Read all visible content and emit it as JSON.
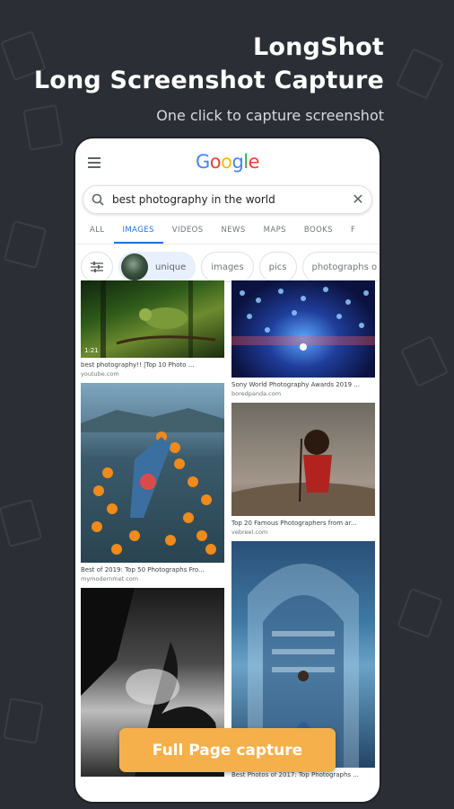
{
  "hero": {
    "line1": "LongShot",
    "line2": "Long Screenshot Capture",
    "subtitle": "One click to capture screenshot"
  },
  "google": {
    "logo_letters": [
      "G",
      "o",
      "o",
      "g",
      "l",
      "e"
    ],
    "logo_colors": [
      "#4285f4",
      "#ea4335",
      "#fbbc05",
      "#4285f4",
      "#34a853",
      "#ea4335"
    ]
  },
  "search": {
    "query": "best photography in the world"
  },
  "tabs": [
    "ALL",
    "IMAGES",
    "VIDEOS",
    "NEWS",
    "MAPS",
    "BOOKS",
    "F"
  ],
  "active_tab": "IMAGES",
  "chips": [
    "unique",
    "images",
    "pics",
    "photographs o"
  ],
  "results": [
    {
      "title": "best photography!! |Top 10 Photo ...",
      "source": "youtube.com",
      "duration": "1:21"
    },
    {
      "title": "Sony World Photography Awards 2019 ...",
      "source": "boredpanda.com"
    },
    {
      "title": "Best of 2019: Top 50 Photographs Fro...",
      "source": "mymodernmet.com"
    },
    {
      "title": "Top 20 Famous Photographers from ar...",
      "source": "vebreel.com"
    },
    {
      "title": "",
      "source": ""
    },
    {
      "title": "Best Photos of 2017: Top Photographs ...",
      "source": ""
    }
  ],
  "cta": {
    "label": "Full Page capture",
    "color": "#f5b04c"
  },
  "colors": {
    "background": "#2b2f35",
    "active_tab": "#1a73e8"
  }
}
